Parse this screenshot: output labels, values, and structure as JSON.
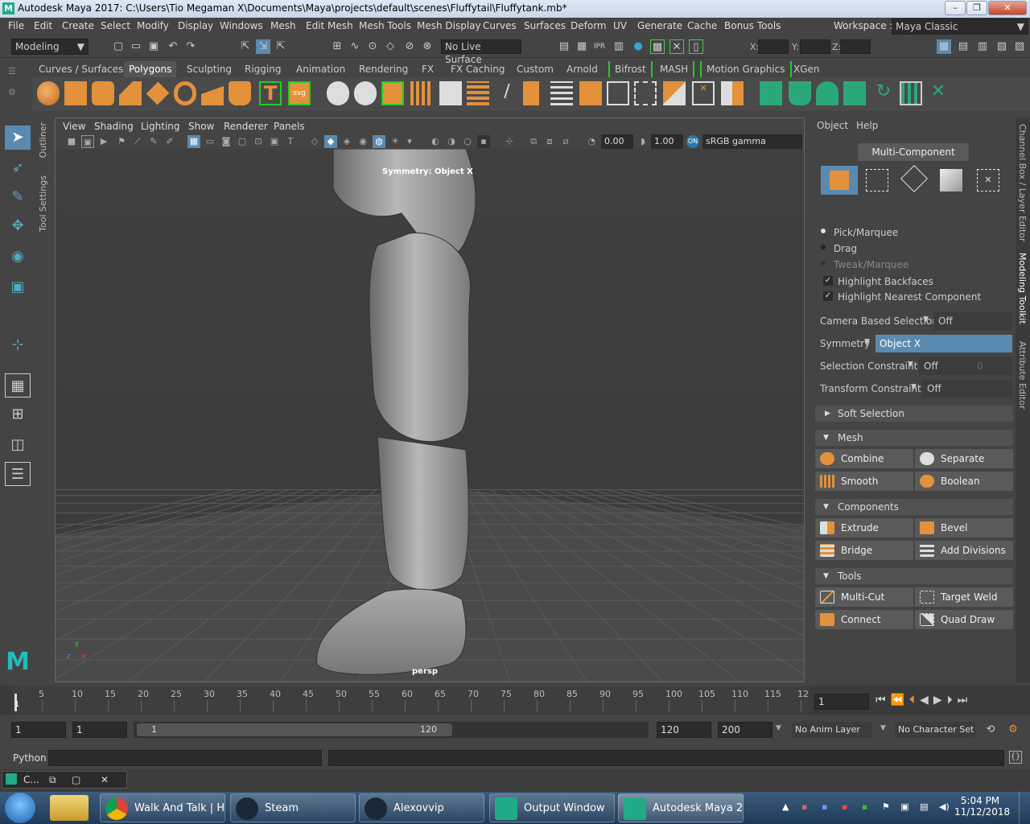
{
  "window": {
    "title": "Autodesk Maya 2017: C:\\Users\\Tio Megaman X\\Documents\\Maya\\projects\\default\\scenes\\Fluffytail\\Fluffytank.mb*",
    "logo_letter": "M",
    "workspace_label": "Workspace :",
    "workspace_value": "Maya Classic"
  },
  "menubar": [
    "File",
    "Edit",
    "Create",
    "Select",
    "Modify",
    "Display",
    "Windows",
    "Mesh",
    "Edit Mesh",
    "Mesh Tools",
    "Mesh Display",
    "Curves",
    "Surfaces",
    "Deform",
    "UV",
    "Generate",
    "Cache",
    "Bonus Tools"
  ],
  "statusline": {
    "mode": "Modeling",
    "live_surface": "No Live Surface",
    "x_label": "X:",
    "y_label": "Y:",
    "z_label": "Z:"
  },
  "shelf_tabs": [
    "Curves / Surfaces",
    "Polygons",
    "Sculpting",
    "Rigging",
    "Animation",
    "Rendering",
    "FX",
    "FX Caching",
    "Custom",
    "Arnold",
    "Bifrost",
    "MASH",
    "Motion Graphics",
    "XGen"
  ],
  "shelf_active": "Polygons",
  "sidetabs": [
    "Outliner",
    "Tool Settings"
  ],
  "viewport": {
    "menu": [
      "View",
      "Shading",
      "Lighting",
      "Show",
      "Renderer",
      "Panels"
    ],
    "exposure": "0.00",
    "gamma": "1.00",
    "color_space": "sRGB gamma",
    "symmetry_label": "Symmetry: Object X",
    "camera": "persp",
    "axis_x": "x",
    "axis_y": "y",
    "axis_z": "z"
  },
  "modeling_toolkit": {
    "menu": [
      "Object",
      "Help"
    ],
    "multi_component": "Multi-Component",
    "pick_marquee": "Pick/Marquee",
    "drag": "Drag",
    "tweak_marquee": "Tweak/Marquee",
    "highlight_backfaces": "Highlight Backfaces",
    "highlight_nearest": "Highlight Nearest Component",
    "camera_based_selection": "Camera Based Selection",
    "camera_based_value": "Off",
    "symmetry": "Symmetry",
    "symmetry_value": "Object X",
    "selection_constraint": "Selection Constraint",
    "selection_constraint_value": "Off",
    "selection_constraint_num": "0",
    "transform_constraint": "Transform Constraint",
    "transform_constraint_value": "Off",
    "soft_selection": "Soft Selection",
    "mesh_section": "Mesh",
    "mesh_buttons": [
      "Combine",
      "Separate",
      "Smooth",
      "Boolean"
    ],
    "components_section": "Components",
    "component_buttons": [
      "Extrude",
      "Bevel",
      "Bridge",
      "Add Divisions"
    ],
    "tools_section": "Tools",
    "tool_buttons": [
      "Multi-Cut",
      "Target Weld",
      "Connect",
      "Quad Draw"
    ]
  },
  "right_vtabs": [
    "Channel Box / Layer Editor",
    "Modeling Toolkit",
    "Attribute Editor"
  ],
  "timeline": {
    "ticks": [
      "5",
      "10",
      "15",
      "20",
      "25",
      "30",
      "35",
      "40",
      "45",
      "50",
      "55",
      "60",
      "65",
      "70",
      "75",
      "80",
      "85",
      "90",
      "95",
      "100",
      "105",
      "110",
      "115",
      "12"
    ],
    "start_marker": "1",
    "current_frame": "1"
  },
  "range": {
    "start": "1",
    "playback_start": "1",
    "slider_start": "1",
    "slider_end": "120",
    "playback_end": "120",
    "end": "200",
    "anim_layer": "No Anim Layer",
    "character_set": "No Character Set"
  },
  "cmdline": {
    "label": "Python"
  },
  "helpline": {
    "label": "C..."
  },
  "taskbar": {
    "buttons": [
      "Walk And Talk | H...",
      "Steam",
      "Alexovvip",
      "Output Window",
      "Autodesk Maya 2..."
    ],
    "time": "5:04 PM",
    "date": "11/12/2018"
  }
}
